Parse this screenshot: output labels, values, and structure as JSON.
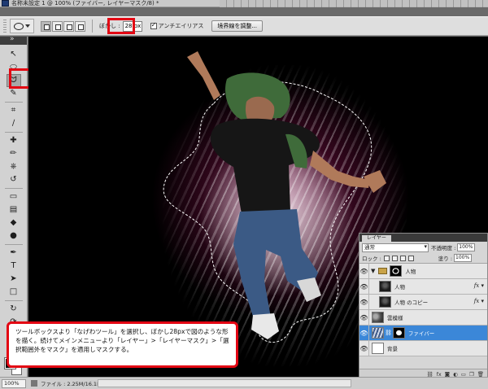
{
  "window": {
    "title": "名称未設定 1 @ 100% (ファイバー, レイヤーマスク/8) *"
  },
  "options": {
    "feather_label": "ぼかし :",
    "feather_value": "28 px",
    "antialias_label": "アンチエイリアス",
    "antialias_checked": true,
    "refine_edge_label": "境界線を調整..."
  },
  "toolbox": {
    "tools": [
      {
        "name": "move-tool",
        "glyph": "↖"
      },
      {
        "name": "marquee-tool",
        "glyph": "⬭"
      },
      {
        "name": "lasso-tool",
        "glyph": "ᗢ",
        "selected": true
      },
      {
        "name": "quick-select-tool",
        "glyph": "✎"
      },
      {
        "name": "crop-tool",
        "glyph": "⌗"
      },
      {
        "name": "eyedropper-tool",
        "glyph": "∕"
      },
      {
        "name": "healing-tool",
        "glyph": "✚"
      },
      {
        "name": "brush-tool",
        "glyph": "✏"
      },
      {
        "name": "clone-tool",
        "glyph": "⎈"
      },
      {
        "name": "history-brush-tool",
        "glyph": "↺"
      },
      {
        "name": "eraser-tool",
        "glyph": "▭"
      },
      {
        "name": "gradient-tool",
        "glyph": "▤"
      },
      {
        "name": "blur-tool",
        "glyph": "◆"
      },
      {
        "name": "dodge-tool",
        "glyph": "●"
      },
      {
        "name": "pen-tool",
        "glyph": "✒"
      },
      {
        "name": "type-tool",
        "glyph": "T"
      },
      {
        "name": "path-select-tool",
        "glyph": "➤"
      },
      {
        "name": "shape-tool",
        "glyph": "□"
      },
      {
        "name": "3d-rotate-tool",
        "glyph": "↻"
      },
      {
        "name": "3d-orbit-tool",
        "glyph": "⟳"
      },
      {
        "name": "hand-tool",
        "glyph": "✋"
      },
      {
        "name": "zoom-tool",
        "glyph": "🔍"
      }
    ],
    "foreground_color": "#000000",
    "background_color": "#ffffff"
  },
  "layers": {
    "tab_label": "レイヤー",
    "blend_mode": "通常",
    "opacity_label": "不透明度 :",
    "opacity_value": "100%",
    "lock_label": "ロック :",
    "fill_label": "塗り :",
    "fill_value": "100%",
    "items": [
      {
        "name": "人物",
        "type": "group",
        "active": false,
        "fx": false
      },
      {
        "name": "人物",
        "type": "layer",
        "active": false,
        "fx": true
      },
      {
        "name": "人物 のコピー",
        "type": "layer",
        "active": false,
        "fx": true
      },
      {
        "name": "雲模様",
        "type": "layer",
        "active": false,
        "fx": false
      },
      {
        "name": "ファイバー",
        "type": "layer",
        "active": true,
        "fx": false
      },
      {
        "name": "背景",
        "type": "layer",
        "active": false,
        "fx": false
      }
    ],
    "footer_icons": [
      "link-icon",
      "fx-icon",
      "mask-icon",
      "adjustment-icon",
      "folder-icon",
      "new-layer-icon",
      "trash-icon"
    ]
  },
  "status": {
    "zoom": "100%",
    "file_info": "ファイル : 2.25M/16.1M"
  },
  "callout": {
    "text": "ツールボックスより「なげわツール」を選択し、ぼかし28pxで図のような形を描く。続けてメインメニューより「レイヤー」>「レイヤーマスク」>「選択範囲外をマスク」を適用しマスクする。",
    "accent": "#e30613"
  }
}
